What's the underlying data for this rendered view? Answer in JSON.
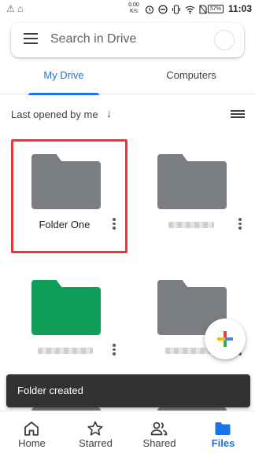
{
  "status_bar": {
    "left_icons": "⚠ ⌂",
    "speed_value": "0.00",
    "speed_unit": "K/s",
    "battery": "57%",
    "time": "11:03"
  },
  "search": {
    "placeholder": "Search in Drive",
    "menu_icon": "hamburger-menu-icon",
    "avatar_icon": "account-avatar"
  },
  "tabs": [
    {
      "label": "My Drive",
      "active": true
    },
    {
      "label": "Computers",
      "active": false
    }
  ],
  "sort": {
    "label": "Last opened by me",
    "direction_icon": "arrow-down-icon",
    "view_icon": "list-view-icon"
  },
  "folders": [
    {
      "name": "Folder One",
      "color": "#7a7d82",
      "selected": true,
      "name_obscured": false
    },
    {
      "name": "",
      "color": "#7a7d82",
      "selected": false,
      "name_obscured": true
    },
    {
      "name": "",
      "color": "#0f9d58",
      "selected": false,
      "name_obscured": true
    },
    {
      "name": "",
      "color": "#7a7d82",
      "selected": false,
      "name_obscured": true
    }
  ],
  "fab": {
    "icon": "plus-icon"
  },
  "snackbar": {
    "text": "Folder created"
  },
  "bottom_nav": [
    {
      "label": "Home",
      "icon": "home-icon",
      "active": false
    },
    {
      "label": "Starred",
      "icon": "star-icon",
      "active": false
    },
    {
      "label": "Shared",
      "icon": "people-icon",
      "active": false
    },
    {
      "label": "Files",
      "icon": "folder-icon",
      "active": true
    }
  ],
  "colors": {
    "accent": "#1a73e8",
    "selection_outline": "#e53935",
    "snackbar_bg": "#323232"
  }
}
